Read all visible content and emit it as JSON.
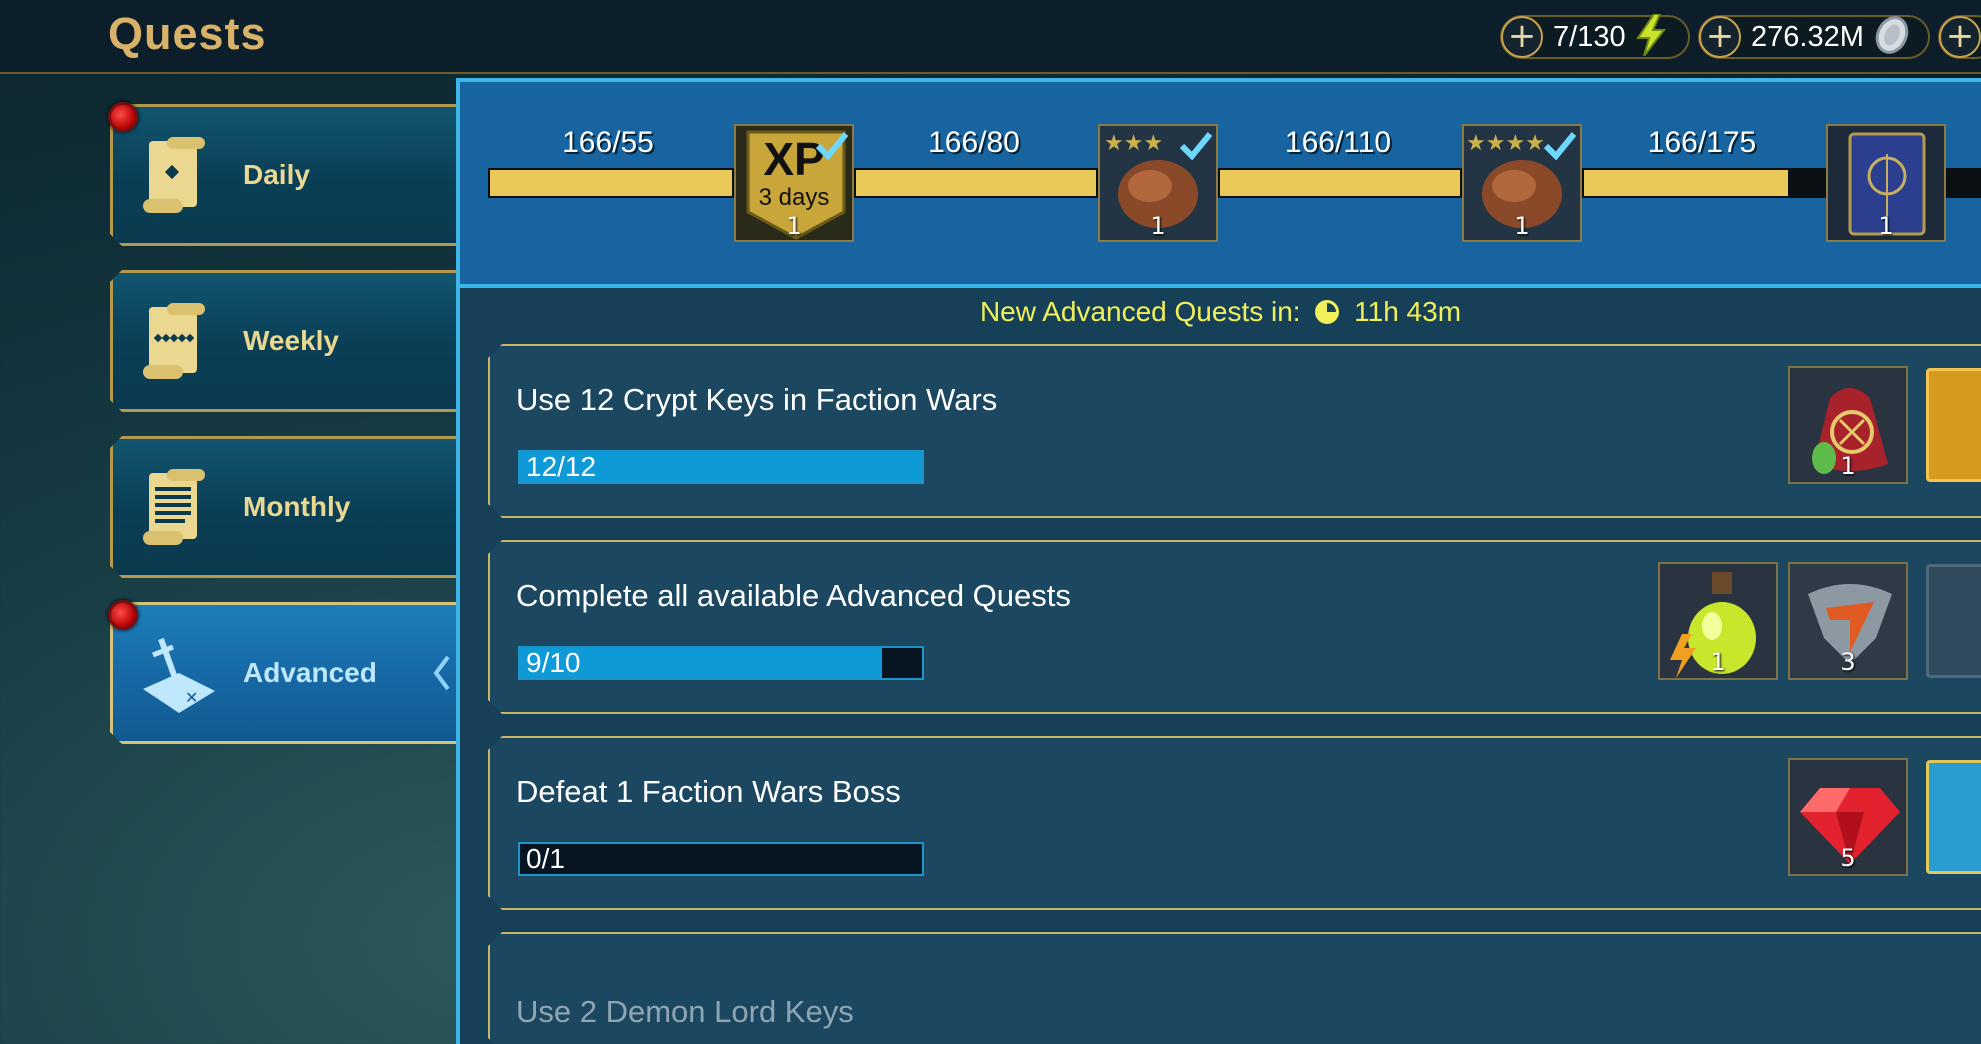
{
  "header": {
    "title": "Quests",
    "energy": "7/130",
    "silver": "276.32M",
    "plus_symbol": "+"
  },
  "sidebar": {
    "tabs": [
      {
        "label": "Daily",
        "icon": "scroll-icon",
        "notification": true,
        "active": false
      },
      {
        "label": "Weekly",
        "icon": "scroll-icon",
        "notification": false,
        "active": false
      },
      {
        "label": "Monthly",
        "icon": "scroll-icon",
        "notification": false,
        "active": false
      },
      {
        "label": "Advanced",
        "icon": "sword-map-icon",
        "notification": true,
        "active": true
      }
    ]
  },
  "milestones": [
    {
      "label": "166/55",
      "progress": 1.0,
      "reward": "xp-boost-icon",
      "reward_text": "XP",
      "reward_sub": "3 days",
      "qty": "1",
      "claimed": true
    },
    {
      "label": "166/80",
      "progress": 1.0,
      "reward": "chicken-3star-icon",
      "qty": "1",
      "claimed": true
    },
    {
      "label": "166/110",
      "progress": 1.0,
      "reward": "chicken-4star-icon",
      "qty": "1",
      "claimed": true
    },
    {
      "label": "166/175",
      "progress": 0.85,
      "reward": "tome-icon",
      "qty": "1",
      "claimed": false
    }
  ],
  "timer": {
    "label": "New Advanced Quests in:",
    "value": "11h 43m"
  },
  "quests": [
    {
      "title": "Use 12 Crypt Keys in Faction Wars",
      "progress_text": "12/12",
      "progress": 1.0,
      "rewards": [
        {
          "icon": "faction-bag-icon",
          "qty": "1"
        }
      ]
    },
    {
      "title": "Complete all available Advanced Quests",
      "progress_text": "9/10",
      "progress": 0.9,
      "rewards": [
        {
          "icon": "energy-potion-icon",
          "qty": "1"
        },
        {
          "icon": "arena-token-icon",
          "qty": "3"
        }
      ]
    },
    {
      "title": "Defeat 1 Faction Wars Boss",
      "progress_text": "0/1",
      "progress": 0.0,
      "rewards": [
        {
          "icon": "ruby-icon",
          "qty": "5"
        }
      ]
    },
    {
      "title": "Use 2 Demon Lord Keys"
    }
  ],
  "colors": {
    "accent_gold": "#d9b26a",
    "panel_blue": "#1864a0",
    "bar_yellow": "#e8c95a",
    "bar_blue": "#0e9ad7",
    "timer_yellow": "#f1f05a"
  }
}
